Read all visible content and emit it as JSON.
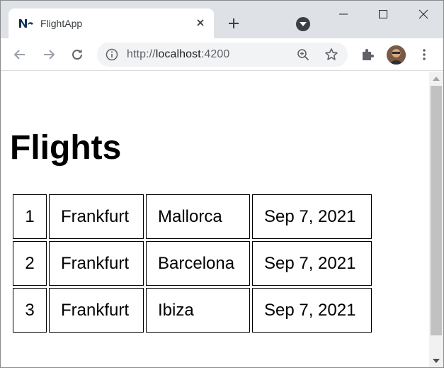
{
  "browser": {
    "tab": {
      "title": "FlightApp",
      "favicon": "nx-logo-icon",
      "close_icon": "close-icon"
    },
    "new_tab_icon": "plus-icon",
    "profile_dropdown_icon": "chevron-down-icon",
    "window_controls": [
      "minimize-icon",
      "maximize-icon",
      "close-icon"
    ],
    "nav_icons": [
      "back-arrow-icon",
      "forward-arrow-icon",
      "reload-icon"
    ],
    "address_bar": {
      "scheme": "http://",
      "host": "localhost",
      "port": ":4200"
    },
    "toolbar_icons": [
      "info-icon",
      "zoom-icon",
      "star-icon",
      "puzzle-icon",
      "avatar",
      "kebab-menu-icon"
    ]
  },
  "page": {
    "heading": "Flights",
    "flights": [
      {
        "id": "1",
        "from": "Frankfurt",
        "to": "Mallorca",
        "date": "Sep 7, 2021"
      },
      {
        "id": "2",
        "from": "Frankfurt",
        "to": "Barcelona",
        "date": "Sep 7, 2021"
      },
      {
        "id": "3",
        "from": "Frankfurt",
        "to": "Ibiza",
        "date": "Sep 7, 2021"
      }
    ]
  },
  "colors": {
    "chrome_frame": "#dee1e6",
    "omnibox": "#f1f3f4",
    "scrollbar_thumb": "#c1c1c1",
    "nx_logo": "#143055"
  }
}
